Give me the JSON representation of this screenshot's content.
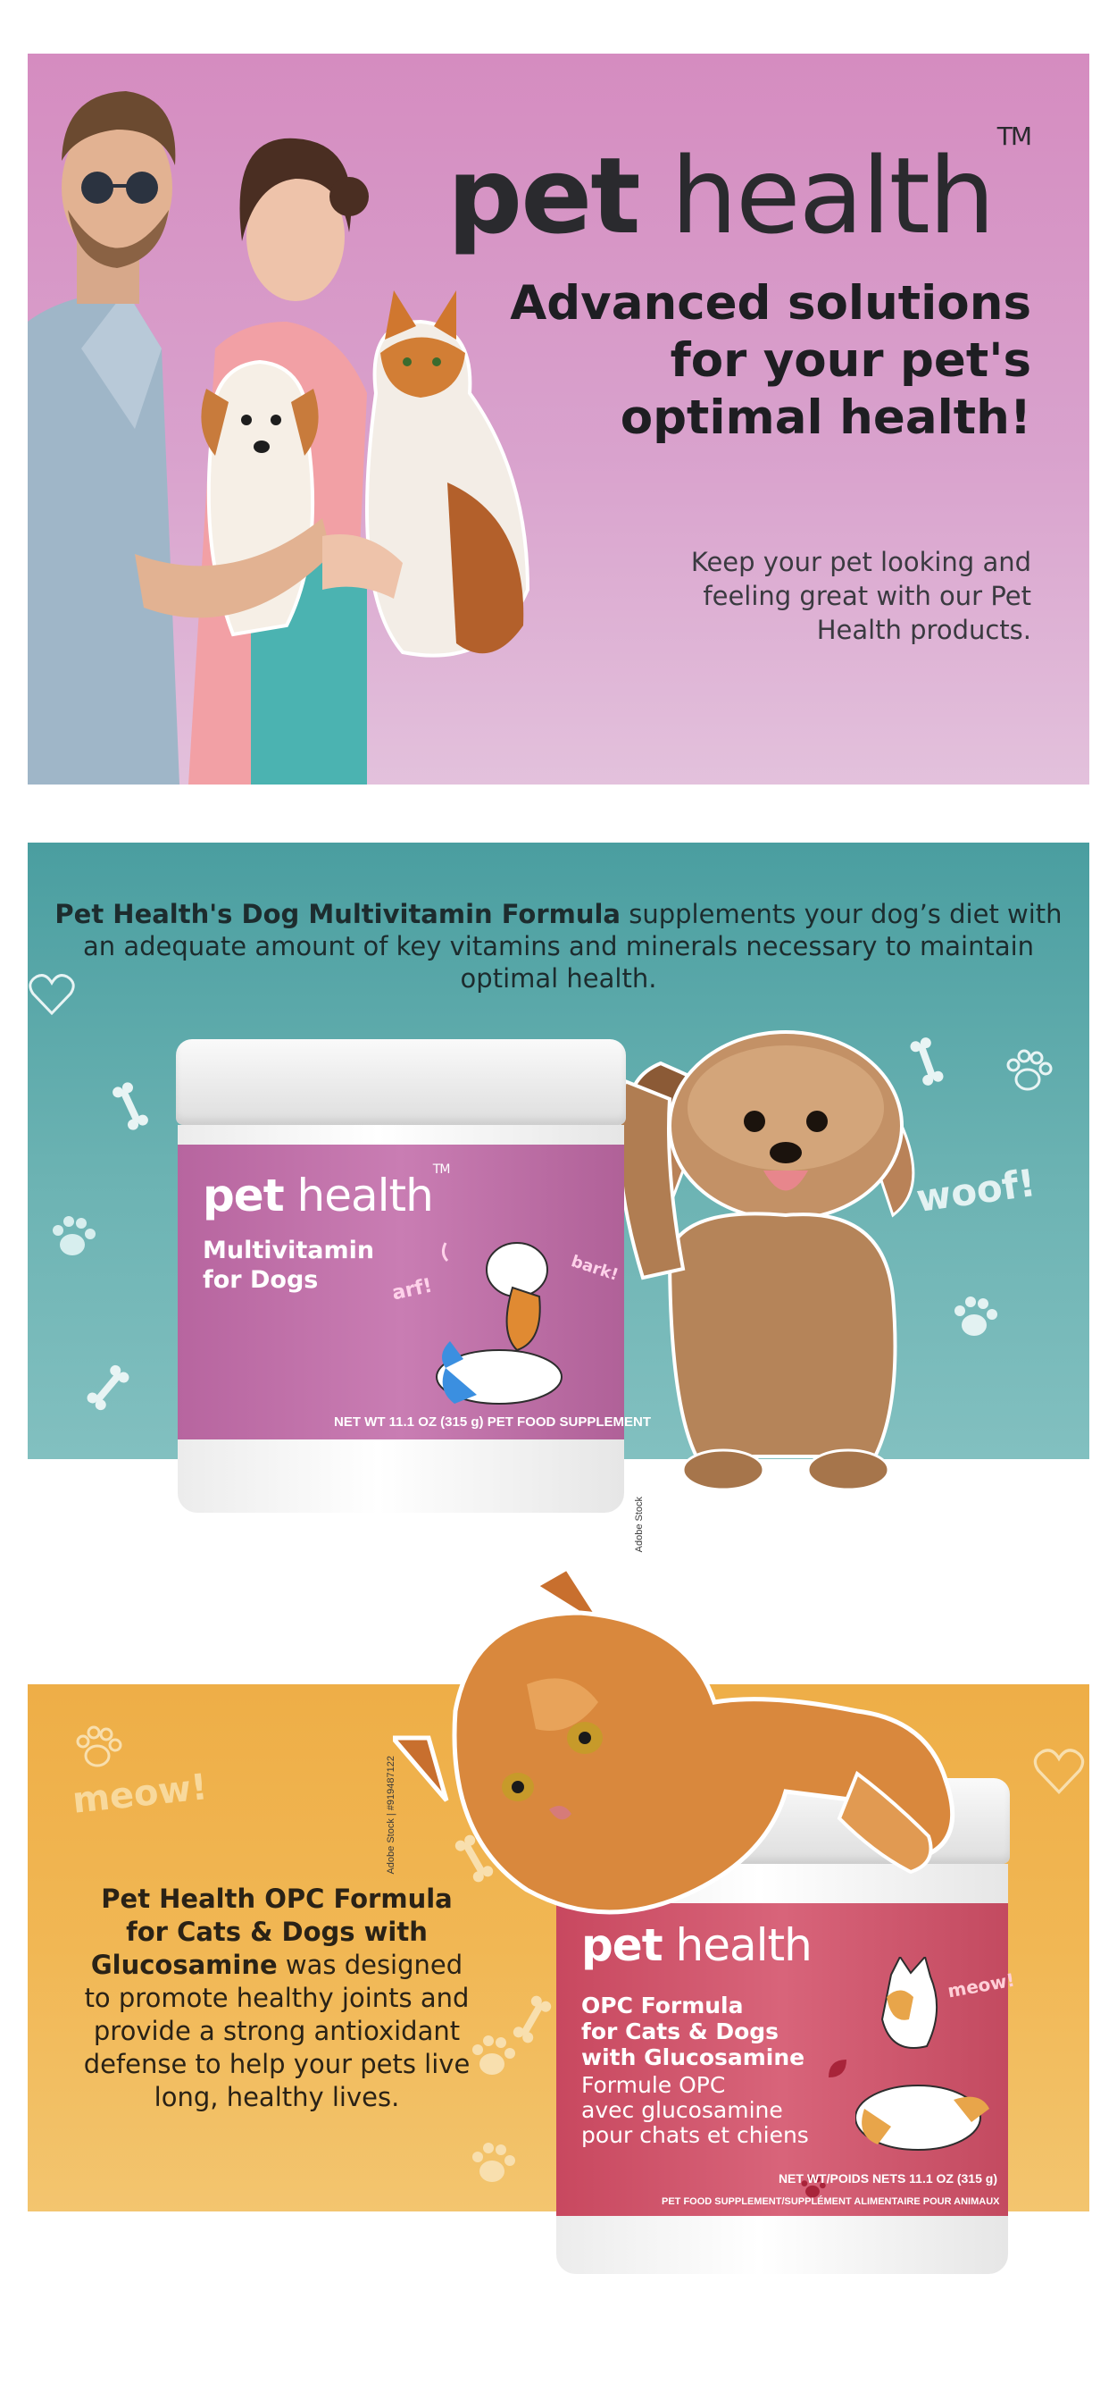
{
  "hero": {
    "logo_bold": "pet",
    "logo_light": "health",
    "logo_tm": "TM",
    "headline": "Advanced solutions for your pet's optimal health!",
    "subtext": "Keep your pet looking and feeling great with our Pet Health products."
  },
  "multivitamin": {
    "intro_bold": "Pet Health's Dog Multivitamin Formula",
    "intro_rest": " supplements your dog’s diet with an adequate amount of key vitamins and minerals necessary to maintain optimal health.",
    "woof": "woof!",
    "jar": {
      "brand_bold": "pet",
      "brand_light": "health",
      "brand_tm": "TM",
      "product_line1": "Multivitamin",
      "product_line2": "for Dogs",
      "bubble_arf": "arf!",
      "bubble_bark": "bark!",
      "net_weight": "NET WT 11.1 OZ (315 g) PET FOOD SUPPLEMENT"
    },
    "side_watermark": "Adobe Stock"
  },
  "opc": {
    "meow_left": "meow!",
    "intro_bold": "Pet Health OPC Formula for Cats & Dogs with Glucosamine",
    "intro_rest": " was designed to promote healthy joints and provide a strong antioxidant defense to help your pets live long, healthy lives.",
    "side_watermark": "Adobe Stock | #919487122",
    "jar": {
      "brand_bold": "pet",
      "brand_light": "health",
      "product_line1": "OPC Formula",
      "product_line2": "for Cats & Dogs",
      "product_line3": "with Glucosamine",
      "fr_line1": "Formule OPC",
      "fr_line2": "avec glucosamine",
      "fr_line3": "pour chats et chiens",
      "bubble_meow": "meow!",
      "net_weight": "NET WT/POIDS NETS 11.1 OZ (315 g)",
      "supplement": "PET FOOD SUPPLEMENT/SUPPLÉMENT ALIMENTAIRE POUR ANIMAUX"
    }
  },
  "colors": {
    "hero_pink": "#d58cc0",
    "teal": "#5aa8a9",
    "orange": "#f1b754",
    "label_purple": "#c07aae",
    "label_red": "#d2566e"
  }
}
